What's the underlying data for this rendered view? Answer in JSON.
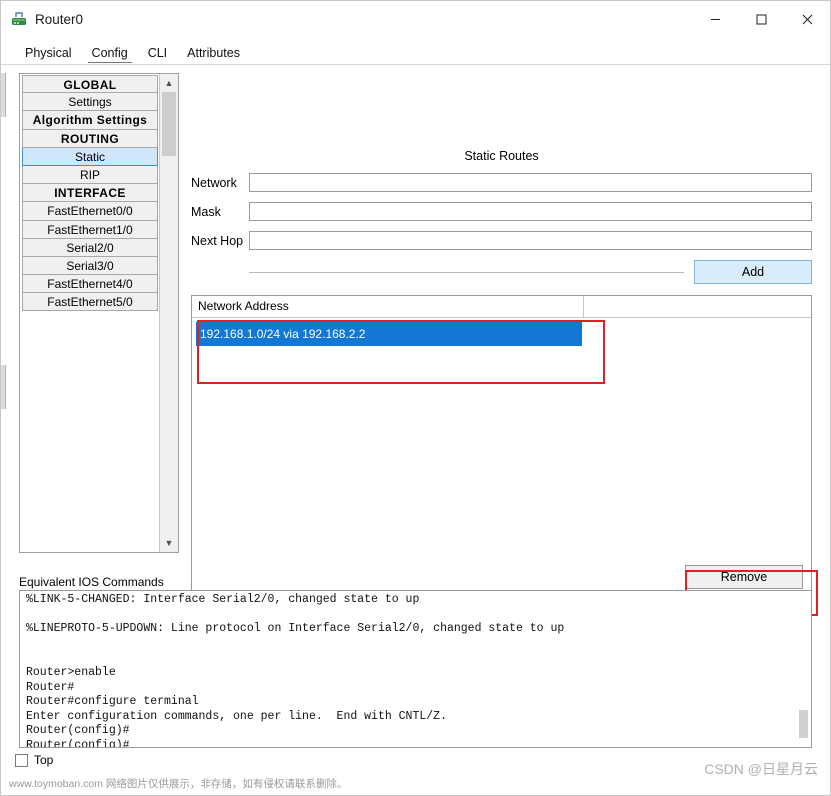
{
  "window": {
    "title": "Router0",
    "icon": "router-icon",
    "minimize": "—",
    "maximize": "☐",
    "close": "✕"
  },
  "tabs": [
    {
      "label": "Physical",
      "active": false
    },
    {
      "label": "Config",
      "active": true
    },
    {
      "label": "CLI",
      "active": false
    },
    {
      "label": "Attributes",
      "active": false
    }
  ],
  "sidebar": {
    "items": [
      {
        "label": "GLOBAL",
        "type": "header"
      },
      {
        "label": "Settings",
        "type": "item"
      },
      {
        "label": "Algorithm Settings",
        "type": "item"
      },
      {
        "label": "ROUTING",
        "type": "header"
      },
      {
        "label": "Static",
        "type": "item",
        "selected": true
      },
      {
        "label": "RIP",
        "type": "item"
      },
      {
        "label": "INTERFACE",
        "type": "header"
      },
      {
        "label": "FastEthernet0/0",
        "type": "item"
      },
      {
        "label": "FastEthernet1/0",
        "type": "item"
      },
      {
        "label": "Serial2/0",
        "type": "item"
      },
      {
        "label": "Serial3/0",
        "type": "item"
      },
      {
        "label": "FastEthernet4/0",
        "type": "item"
      },
      {
        "label": "FastEthernet5/0",
        "type": "item"
      }
    ],
    "scroll_up": "▲",
    "scroll_down": "▼"
  },
  "main": {
    "title": "Static Routes",
    "fields": [
      {
        "label": "Network",
        "value": "",
        "placeholder": ""
      },
      {
        "label": "Mask",
        "value": "",
        "placeholder": ""
      },
      {
        "label": "Next Hop",
        "value": "",
        "placeholder": ""
      }
    ],
    "add_button": "Add",
    "table": {
      "column": "Network Address",
      "rows": [
        "192.168.1.0/24 via 192.168.2.2"
      ]
    },
    "remove_button": "Remove"
  },
  "ios": {
    "label": "Equivalent IOS Commands",
    "text": "%LINK-5-CHANGED: Interface Serial2/0, changed state to up\n\n%LINEPROTO-5-UPDOWN: Line protocol on Interface Serial2/0, changed state to up\n\n\nRouter>enable\nRouter#\nRouter#configure terminal\nEnter configuration commands, one per line.  End with CNTL/Z.\nRouter(config)#\nRouter(config)#"
  },
  "footer": {
    "top_label": "Top",
    "watermark_left": "www.toymoban.com 网络图片仅供展示，非存储，如有侵权请联系删除。",
    "watermark_right": "CSDN @日星月云"
  },
  "colors": {
    "selection": "#1278d4",
    "sidebar_selected": "#cfe6fb",
    "annotation": "#e02020",
    "add_button": "#d9ecfb"
  }
}
